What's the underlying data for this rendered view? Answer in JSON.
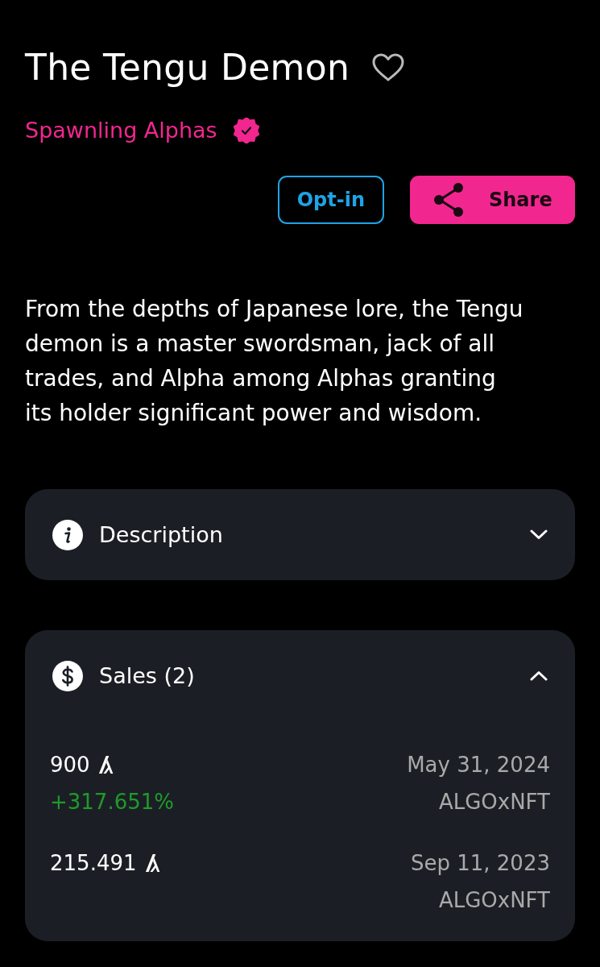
{
  "title": "The Tengu Demon",
  "favorited": false,
  "collection": {
    "name": "Spawnling Alphas",
    "verified": true
  },
  "actions": [
    {
      "kind": "outline",
      "label": "Opt-in"
    },
    {
      "kind": "share",
      "label": "Share"
    }
  ],
  "summary": "From the depths of Japanese lore, the Tengu demon is a master swordsman, jack of all trades, and Alpha among Alphas granting its holder significant power and wisdom.",
  "panels": [
    {
      "kind": "info",
      "title": "Description",
      "expanded": false
    },
    {
      "kind": "sales",
      "title": "Sales (2)",
      "expanded": true,
      "sales": [
        {
          "price": "900",
          "change": "+317.651%",
          "date": "May 31, 2024",
          "market": "ALGOxNFT"
        },
        {
          "price": "215.491",
          "date": "Sep 11, 2023",
          "market": "ALGOxNFT"
        }
      ]
    }
  ]
}
